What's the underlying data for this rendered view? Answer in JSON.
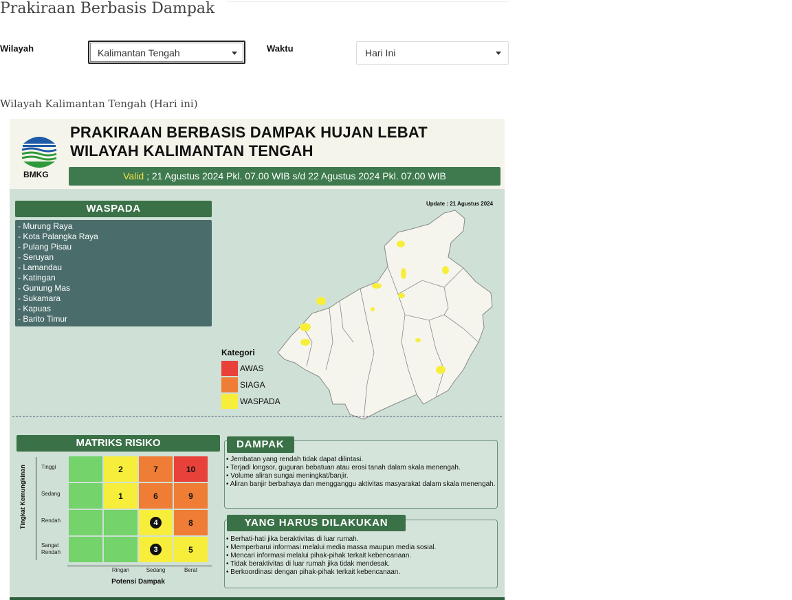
{
  "page": {
    "title": "Prakiraan Berbasis Dampak",
    "subtitle": "Wilayah Kalimantan Tengah (Hari ini)"
  },
  "filters": {
    "wilayah_label": "Wilayah",
    "wilayah_value": "Kalimantan Tengah",
    "waktu_label": "Waktu",
    "waktu_value": "Hari Ini"
  },
  "infographic": {
    "logo_text": "BMKG",
    "title_line1": "PRAKIRAAN BERBASIS DAMPAK HUJAN LEBAT",
    "title_line2": "WILAYAH KALIMANTAN TENGAH",
    "valid_word": "Valid",
    "valid_rest": " ; 21 Agustus 2024 Pkl. 07.00 WIB s/d 22 Agustus 2024 Pkl. 07.00 WIB",
    "update_text": "Update : 21 Agustus 2024",
    "waspada_title": "WASPADA",
    "waspada_items": [
      "- Murung Raya",
      "- Kota Palangka Raya",
      "- Pulang Pisau",
      "- Seruyan",
      "- Lamandau",
      "- Katingan",
      "- Gunung Mas",
      "- Sukamara",
      "- Kapuas",
      "- Barito Timur"
    ],
    "legend": {
      "title": "Kategori",
      "items": [
        {
          "label": "AWAS",
          "color": "#e8413a"
        },
        {
          "label": "SIAGA",
          "color": "#f07d35"
        },
        {
          "label": "WASPADA",
          "color": "#f7ee3c"
        }
      ]
    },
    "matrix": {
      "title": "MATRIKS RISIKO",
      "y_axis_title": "Tingkat Kemungkinan",
      "x_axis_title": "Potensi Dampak",
      "rows": [
        "Tinggi",
        "Sedang",
        "Rendah",
        "Sangat Rendah"
      ],
      "row_line1": [
        "Tinggi",
        "Sedang",
        "Rendah",
        "Sangat"
      ],
      "row_line2": [
        "",
        "",
        "",
        "Rendah"
      ],
      "cols": [
        "Ringan",
        "Sedang",
        "Berat"
      ],
      "cells": [
        [
          "",
          "2",
          "7",
          "10"
        ],
        [
          "",
          "1",
          "6",
          "9"
        ],
        [
          "",
          "",
          "4",
          "8"
        ],
        [
          "",
          "",
          "3",
          "5"
        ]
      ],
      "colors": [
        [
          "#74d36a",
          "#f7ee3c",
          "#f07d35",
          "#e8413a"
        ],
        [
          "#74d36a",
          "#f7ee3c",
          "#f07d35",
          "#f07d35"
        ],
        [
          "#74d36a",
          "#74d36a",
          "#f7ee3c",
          "#f07d35"
        ],
        [
          "#74d36a",
          "#74d36a",
          "#f7ee3c",
          "#f7ee3c"
        ]
      ],
      "circled": [
        "4",
        "3"
      ]
    },
    "dampak": {
      "title": "DAMPAK",
      "items": [
        "• Jembatan yang rendah tidak dapat dilintasi.",
        "• Terjadi longsor, guguran bebatuan atau erosi tanah dalam skala menengah.",
        "• Volume aliran sungai meningkat/banjir.",
        "• Aliran banjir berbahaya dan mengganggu aktivitas masyarakat dalam skala menengah."
      ]
    },
    "tindakan": {
      "title": "YANG HARUS DILAKUKAN",
      "items": [
        "• Berhati-hati jika beraktivitas di luar rumah.",
        "• Memperbarui informasi melalui media massa maupun media sosial.",
        "• Mencari informasi melalui pihak-pihak terkait kebencanaan.",
        "• Tidak beraktivitas di luar rumah jika tidak mendesak.",
        "• Berkoordinasi dengan pihak-pihak terkait kebencanaan."
      ]
    }
  }
}
